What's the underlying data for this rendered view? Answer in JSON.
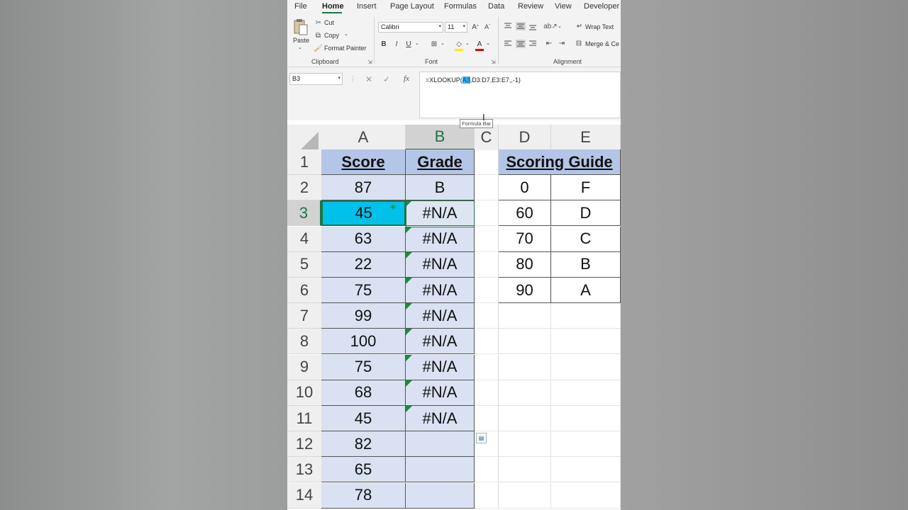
{
  "menu": {
    "tabs": [
      "File",
      "Home",
      "Insert",
      "Page Layout",
      "Formulas",
      "Data",
      "Review",
      "View",
      "Developer"
    ],
    "active": "Home"
  },
  "ribbon": {
    "clipboard": {
      "paste": "Paste",
      "cut": "Cut",
      "copy": "Copy",
      "format_painter": "Format Painter",
      "label": "Clipboard"
    },
    "font": {
      "name": "Calibri",
      "size": "11",
      "bold": "B",
      "italic": "I",
      "underline": "U",
      "label": "Font"
    },
    "alignment": {
      "wrap_text": "Wrap Text",
      "merge": "Merge & Ce",
      "label": "Alignment"
    }
  },
  "formula_bar": {
    "name_box": "B3",
    "formula_prefix": "=XLOOKUP(",
    "formula_ref": "A3",
    "formula_suffix": ",D3:D7,E3:E7,,-1)",
    "tooltip": "Formula Bar",
    "fx": "fx"
  },
  "columns": [
    "A",
    "B",
    "C",
    "D",
    "E"
  ],
  "selected_cell": "B3",
  "rows": [
    {
      "n": "1",
      "a": "Score",
      "b": "Grade",
      "d": "Scoring Guide",
      "e": ""
    },
    {
      "n": "2",
      "a": "87",
      "b": "B",
      "d": "0",
      "e": "F"
    },
    {
      "n": "3",
      "a": "45",
      "b": "#N/A",
      "d": "60",
      "e": "D"
    },
    {
      "n": "4",
      "a": "63",
      "b": "#N/A",
      "d": "70",
      "e": "C"
    },
    {
      "n": "5",
      "a": "22",
      "b": "#N/A",
      "d": "80",
      "e": "B"
    },
    {
      "n": "6",
      "a": "75",
      "b": "#N/A",
      "d": "90",
      "e": "A"
    },
    {
      "n": "7",
      "a": "99",
      "b": "#N/A",
      "d": "",
      "e": ""
    },
    {
      "n": "8",
      "a": "100",
      "b": "#N/A",
      "d": "",
      "e": ""
    },
    {
      "n": "9",
      "a": "75",
      "b": "#N/A",
      "d": "",
      "e": ""
    },
    {
      "n": "10",
      "a": "68",
      "b": "#N/A",
      "d": "",
      "e": ""
    },
    {
      "n": "11",
      "a": "45",
      "b": "#N/A",
      "d": "",
      "e": ""
    },
    {
      "n": "12",
      "a": "82",
      "b": "",
      "d": "",
      "e": ""
    },
    {
      "n": "13",
      "a": "65",
      "b": "",
      "d": "",
      "e": ""
    },
    {
      "n": "14",
      "a": "78",
      "b": "",
      "d": "",
      "e": ""
    }
  ],
  "colors": {
    "accent": "#217346",
    "header_fill": "#b4c6e7",
    "data_fill": "#d9e1f2",
    "active_fill": "#00c1ea",
    "ref_highlight": "#35b6e4"
  }
}
